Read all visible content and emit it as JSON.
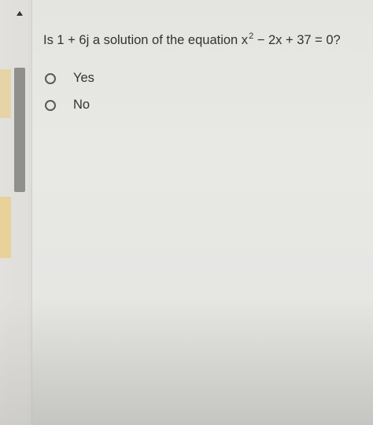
{
  "question": {
    "prefix": "Is 1 + 6j a solution of the equation x",
    "exponent": "2",
    "suffix": " − 2x + 37 = 0?"
  },
  "options": [
    {
      "label": "Yes",
      "selected": false
    },
    {
      "label": "No",
      "selected": false
    }
  ],
  "colors": {
    "text": "#333333",
    "radio_border": "#5a5a5a",
    "scroll_thumb": "#8f8f8c",
    "rail_marker": "#e9cf8e"
  },
  "icons": {
    "scroll_up": "triangle-up-icon"
  }
}
